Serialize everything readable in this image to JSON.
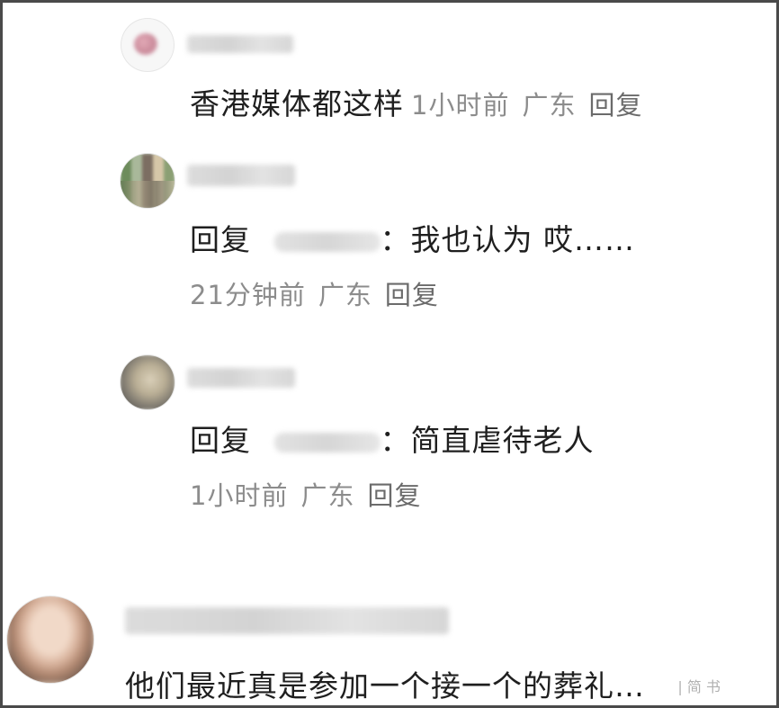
{
  "comments": [
    {
      "text": "香港媒体都这样",
      "time": "1小时前",
      "location": "广东",
      "reply_label": "回复"
    },
    {
      "reply_prefix": "回复",
      "text": "：我也认为 哎……",
      "time": "21分钟前",
      "location": "广东",
      "reply_label": "回复"
    },
    {
      "reply_prefix": "回复",
      "text": "：简直虐待老人",
      "time": "1小时前",
      "location": "广东",
      "reply_label": "回复"
    },
    {
      "text": "他们最近真是参加一个接一个的葬礼…"
    }
  ],
  "watermark": "|  简  书"
}
